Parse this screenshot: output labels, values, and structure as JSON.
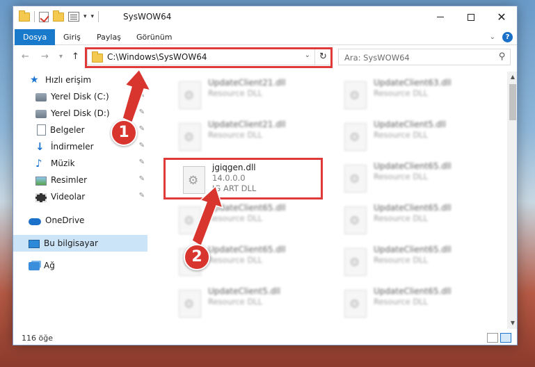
{
  "window": {
    "title": "SysWOW64",
    "controls": {
      "minimize": "",
      "maximize": "",
      "close": "✕"
    }
  },
  "ribbon": {
    "tabs": [
      "Dosya",
      "Giriş",
      "Paylaş",
      "Görünüm"
    ],
    "help": "?"
  },
  "nav": {
    "back": "←",
    "forward": "→",
    "recent": "▾",
    "up": "↑",
    "address": "C:\\Windows\\SysWOW64",
    "refresh": "↻",
    "search_placeholder": "Ara: SysWOW64",
    "search_icon": "⚲"
  },
  "sidebar": {
    "items": [
      {
        "label": "Hızlı erişim",
        "icon": "star-icon"
      },
      {
        "label": "Yerel Disk (C:)",
        "icon": "disk-icon",
        "pinned": true
      },
      {
        "label": "Yerel Disk (D:)",
        "icon": "disk-icon",
        "pinned": true
      },
      {
        "label": "Belgeler",
        "icon": "documents-icon",
        "pinned": true
      },
      {
        "label": "İndirmeler",
        "icon": "download-icon",
        "pinned": true
      },
      {
        "label": "Müzik",
        "icon": "music-icon",
        "pinned": true
      },
      {
        "label": "Resimler",
        "icon": "pictures-icon",
        "pinned": true
      },
      {
        "label": "Videolar",
        "icon": "videos-icon",
        "pinned": true
      },
      {
        "label": "OneDrive",
        "icon": "cloud-icon"
      },
      {
        "label": "Bu bilgisayar",
        "icon": "computer-icon",
        "selected": true
      },
      {
        "label": "Ağ",
        "icon": "network-icon"
      }
    ]
  },
  "files": [
    {
      "name": "UpdateClient21.dll",
      "line2": "Resource DLL",
      "line3": ""
    },
    {
      "name": "UpdateClient63.dll",
      "line2": "Resource DLL",
      "line3": ""
    },
    {
      "name": "UpdateClient21.dll",
      "line2": "Resource DLL",
      "line3": ""
    },
    {
      "name": "UpdateClient5.dll",
      "line2": "Resource DLL",
      "line3": ""
    },
    {
      "name": "jgiqgen.dll",
      "line2": "14.0.0.0",
      "line3": "JG ART DLL",
      "highlighted": true
    },
    {
      "name": "UpdateClient65.dll",
      "line2": "Resource DLL",
      "line3": ""
    },
    {
      "name": "UpdateClient65.dll",
      "line2": "Resource DLL",
      "line3": ""
    },
    {
      "name": "UpdateClient65.dll",
      "line2": "Resource DLL",
      "line3": ""
    },
    {
      "name": "UpdateClient65.dll",
      "line2": "Resource DLL",
      "line3": ""
    },
    {
      "name": "UpdateClient65.dll",
      "line2": "Resource DLL",
      "line3": ""
    },
    {
      "name": "UpdateClient5.dll",
      "line2": "Resource DLL",
      "line3": ""
    },
    {
      "name": "UpdateClient65.dll",
      "line2": "Resource DLL",
      "line3": ""
    }
  ],
  "status": {
    "count": "116 öğe"
  },
  "annotations": {
    "step1": "1",
    "step2": "2",
    "color": "#d9352f"
  }
}
